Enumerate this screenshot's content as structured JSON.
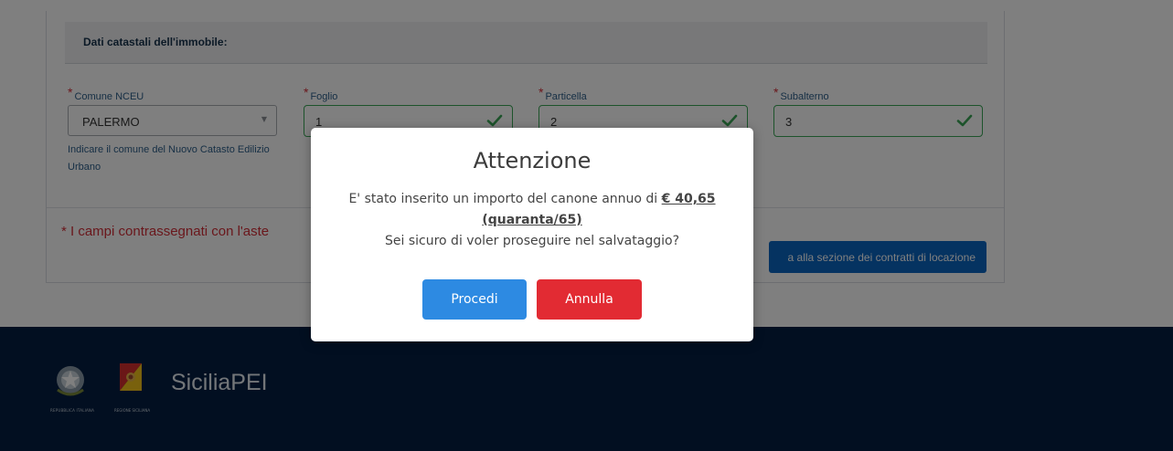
{
  "form": {
    "section_title": "Dati catastali dell'immobile:",
    "fields": [
      {
        "label": "Comune NCEU",
        "value": "PALERMO",
        "type": "select"
      },
      {
        "label": "Foglio",
        "value": "1",
        "type": "input"
      },
      {
        "label": "Particella",
        "value": "2",
        "type": "input"
      },
      {
        "label": "Subalterno",
        "value": "3",
        "type": "input"
      }
    ],
    "required_marker": "*",
    "comune_hint": "Indicare il comune del Nuovo Catasto Edilizio Urbano",
    "required_note": "* I campi contrassegnati con l'aste",
    "back_button_label": "a alla sezione dei contratti di locazione"
  },
  "modal": {
    "title": "Attenzione",
    "message_prefix": "E' stato inserito un importo del canone annuo di ",
    "amount": "€ 40,65",
    "amount_words": "(quaranta/65)",
    "question": "Sei sicuro di voler proseguire nel salvataggio?",
    "confirm_label": "Procedi",
    "cancel_label": "Annulla"
  },
  "footer": {
    "brand": "SiciliaPEI",
    "emblem_caption": "REPUBBLICA ITALIANA",
    "region_caption": "REGIONE SICILIANA"
  },
  "colors": {
    "primary": "#2d8ae2",
    "danger": "#e22b33",
    "valid": "#3aa657",
    "footer_bg": "#041e42"
  },
  "icons": {
    "field_valid": "check-icon",
    "select_caret": "caret-down-icon"
  }
}
